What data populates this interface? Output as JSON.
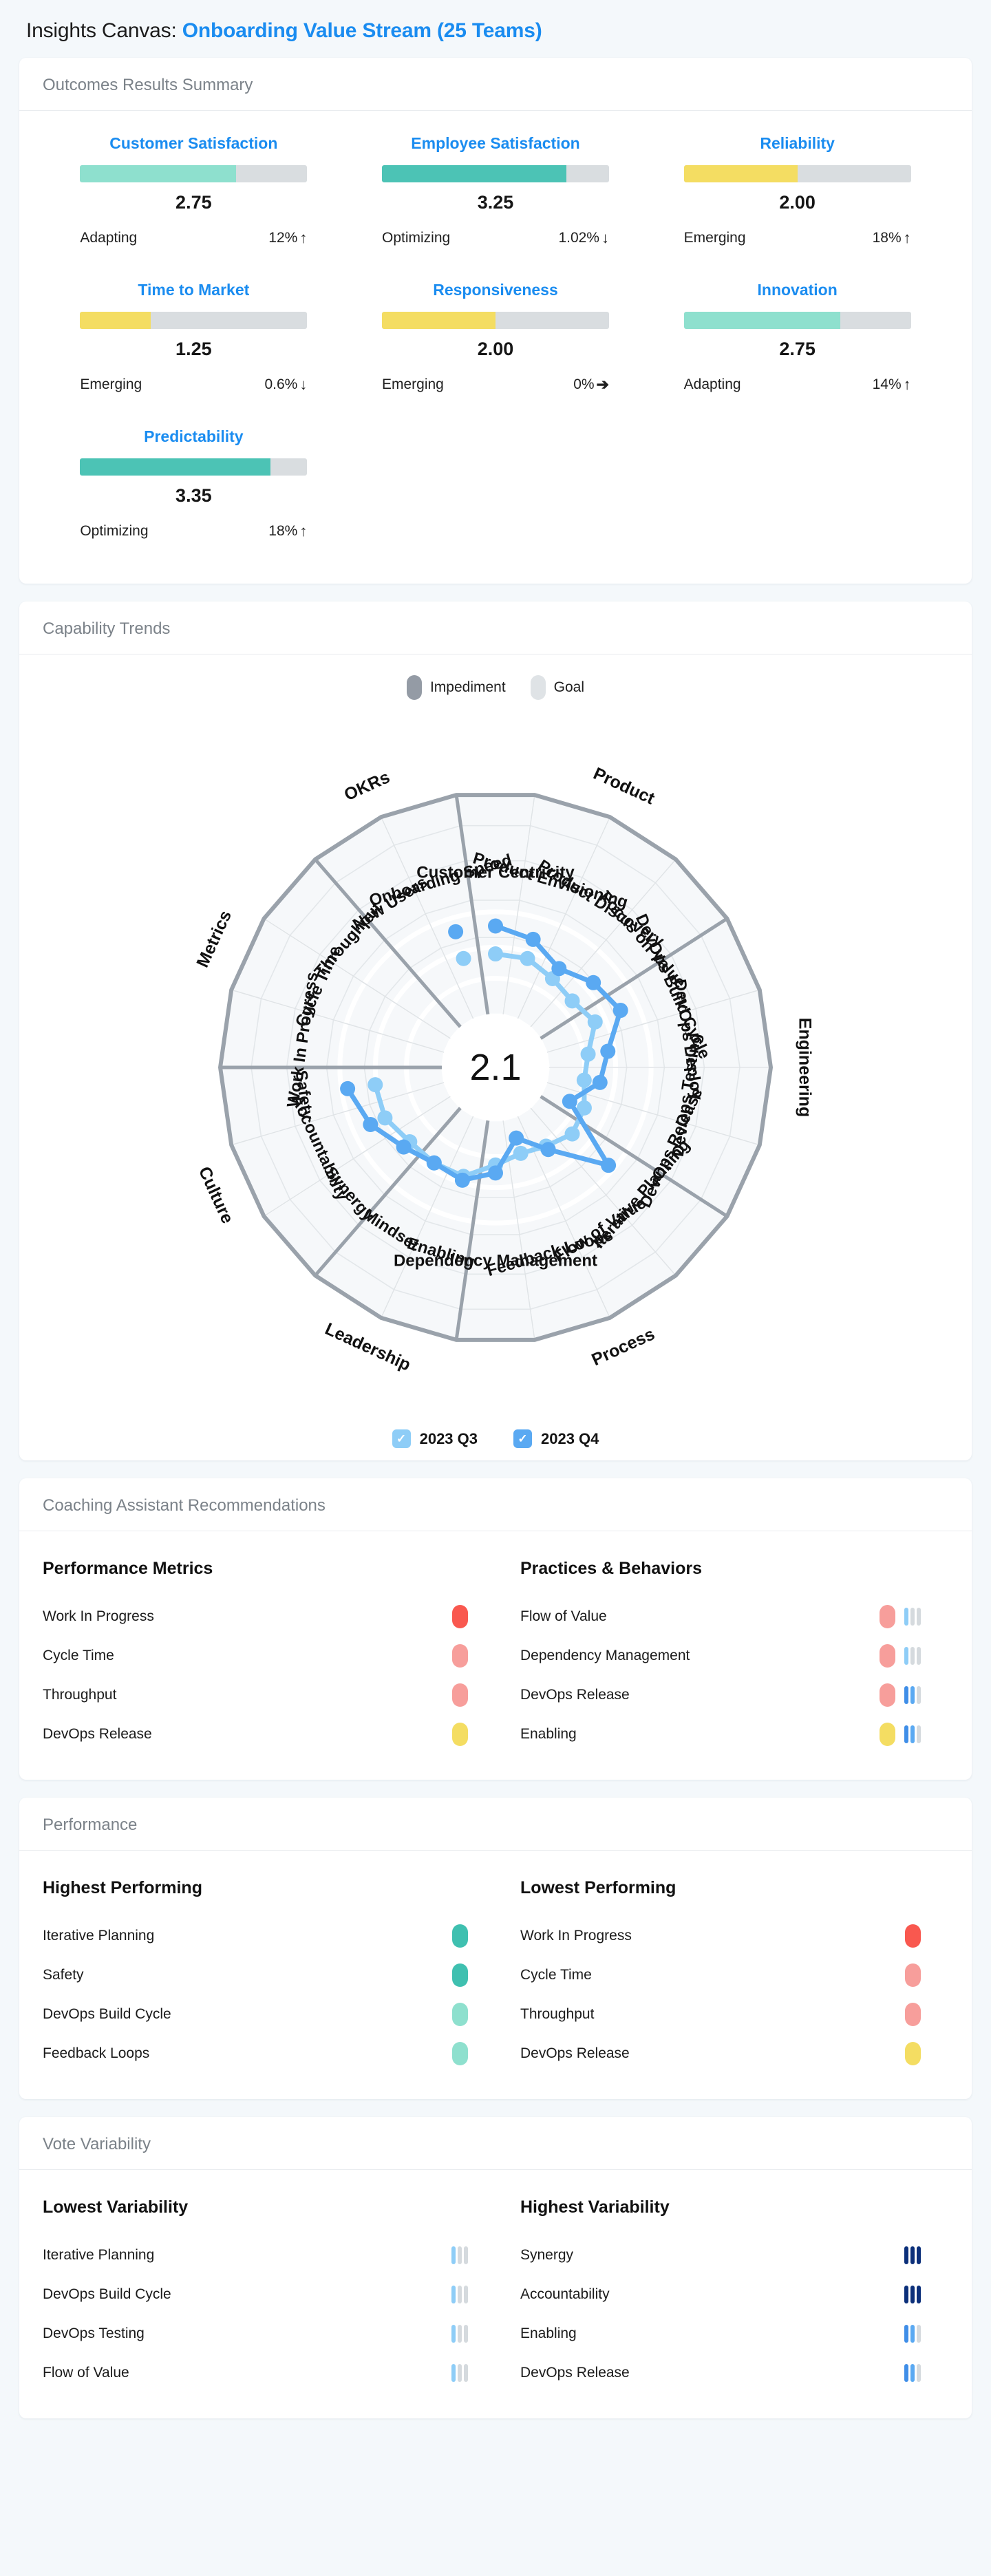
{
  "header": {
    "prefix": "Insights Canvas: ",
    "project": "Onboarding Value Stream (25 Teams)"
  },
  "outcomes": {
    "section_title": "Outcomes Results Summary",
    "max_score": 4,
    "items": [
      {
        "name": "Customer Satisfaction",
        "score": "2.75",
        "value": 2.75,
        "level": "Adapting",
        "delta": "12%",
        "direction": "up",
        "color": "#8ee0ce"
      },
      {
        "name": "Employee Satisfaction",
        "score": "3.25",
        "value": 3.25,
        "level": "Optimizing",
        "delta": "1.02%",
        "direction": "down",
        "color": "#4cc3b5"
      },
      {
        "name": "Reliability",
        "score": "2.00",
        "value": 2.0,
        "level": "Emerging",
        "delta": "18%",
        "direction": "up",
        "color": "#f4dd62"
      },
      {
        "name": "Time to Market",
        "score": "1.25",
        "value": 1.25,
        "level": "Emerging",
        "delta": "0.6%",
        "direction": "down",
        "color": "#f4dd62"
      },
      {
        "name": "Responsiveness",
        "score": "2.00",
        "value": 2.0,
        "level": "Emerging",
        "delta": "0%",
        "direction": "flat",
        "color": "#f4dd62"
      },
      {
        "name": "Innovation",
        "score": "2.75",
        "value": 2.75,
        "level": "Adapting",
        "delta": "14%",
        "direction": "up",
        "color": "#8ee0ce"
      },
      {
        "name": "Predictability",
        "score": "3.35",
        "value": 3.35,
        "level": "Optimizing",
        "delta": "18%",
        "direction": "up",
        "color": "#4cc3b5"
      }
    ]
  },
  "capability": {
    "section_title": "Capability Trends",
    "legend": [
      {
        "label": "Impediment",
        "color": "#949ba5"
      },
      {
        "label": "Goal",
        "color": "#dfe3e6"
      }
    ],
    "center_value": "2.1",
    "quarters": [
      {
        "label": "2023 Q3",
        "color": "#8ecdf7",
        "checked": true
      },
      {
        "label": "2023 Q4",
        "color": "#5aa9f2",
        "checked": true
      }
    ],
    "groups": [
      "Product",
      "Engineering",
      "Process",
      "Leadership",
      "Culture",
      "Metrics",
      "OKRs"
    ],
    "chart_data": {
      "type": "radar",
      "title": "Capability Trends",
      "axis_max": 4,
      "categories": [
        "Customer Centricity",
        "Product Envisioning",
        "Product Discovery",
        "Focus on Value",
        "DevOps Build Cycle",
        "DevOps Deploy",
        "DevOps Testing",
        "DevOps Release",
        "Iterative Planning",
        "Flow of Value",
        "Feedback Loops",
        "Dependency Management",
        "Enabling",
        "Mindset",
        "Synergy",
        "Accountability",
        "Safety",
        "Work In Progress",
        "Cycle Time",
        "Throughput",
        "New Users",
        "Onboarding Speed"
      ],
      "group_labels": [
        "Product",
        "Engineering",
        "Process",
        "Leadership",
        "Culture",
        "Metrics",
        "OKRs"
      ],
      "series": [
        {
          "name": "2023 Q3",
          "color": "#8ecdf7",
          "values": [
            1.5,
            1.5,
            1.3,
            1.2,
            1.4,
            1.0,
            0.9,
            1.1,
            1.2,
            1.0,
            0.9,
            1.1,
            1.5,
            1.5,
            1.5,
            1.7,
            1.7,
            0.0,
            0.0,
            0.0,
            0.0,
            1.5
          ]
        },
        {
          "name": "2023 Q4",
          "color": "#5aa9f2",
          "values": [
            2.2,
            2.0,
            1.6,
            1.9,
            2.1,
            1.5,
            1.3,
            0.7,
            2.4,
            1.1,
            0.5,
            1.3,
            1.6,
            1.5,
            1.7,
            2.1,
            2.4,
            0.0,
            0.0,
            0.0,
            0.0,
            2.2
          ]
        }
      ],
      "legend_position": "bottom",
      "grid": true
    }
  },
  "coaching": {
    "section_title": "Coaching Assistant Recommendations",
    "left": {
      "title": "Performance Metrics",
      "rows": [
        {
          "label": "Work In Progress",
          "dot": "#f9584f"
        },
        {
          "label": "Cycle Time",
          "dot": "#f79e9b"
        },
        {
          "label": "Throughput",
          "dot": "#f79e9b"
        },
        {
          "label": "DevOps Release",
          "dot": "#f4dd62"
        }
      ]
    },
    "right": {
      "title": "Practices & Behaviors",
      "rows": [
        {
          "label": "Flow of Value",
          "dot": "#f79e9b",
          "bars": [
            "#8ecdf7",
            "#d5dade",
            "#d5dade"
          ]
        },
        {
          "label": "Dependency Management",
          "dot": "#f79e9b",
          "bars": [
            "#8ecdf7",
            "#d5dade",
            "#d5dade"
          ]
        },
        {
          "label": "DevOps Release",
          "dot": "#f79e9b",
          "bars": [
            "#3f8ee8",
            "#5aa9f2",
            "#d5dade"
          ]
        },
        {
          "label": "Enabling",
          "dot": "#f4dd62",
          "bars": [
            "#3f8ee8",
            "#5aa9f2",
            "#d5dade"
          ]
        }
      ]
    }
  },
  "performance": {
    "section_title": "Performance",
    "left": {
      "title": "Highest Performing",
      "rows": [
        {
          "label": "Iterative Planning",
          "dot": "#3fc0b0"
        },
        {
          "label": "Safety",
          "dot": "#3fc0b0"
        },
        {
          "label": "DevOps Build Cycle",
          "dot": "#8ee0ce"
        },
        {
          "label": "Feedback Loops",
          "dot": "#8ee0ce"
        }
      ]
    },
    "right": {
      "title": "Lowest Performing",
      "rows": [
        {
          "label": "Work In Progress",
          "dot": "#f9584f"
        },
        {
          "label": "Cycle Time",
          "dot": "#f79e9b"
        },
        {
          "label": "Throughput",
          "dot": "#f79e9b"
        },
        {
          "label": "DevOps Release",
          "dot": "#f4dd62"
        }
      ]
    }
  },
  "variability": {
    "section_title": "Vote Variability",
    "left": {
      "title": "Lowest Variability",
      "rows": [
        {
          "label": "Iterative Planning",
          "bars": [
            "#8ecdf7",
            "#d5dade",
            "#d5dade"
          ]
        },
        {
          "label": "DevOps Build Cycle",
          "bars": [
            "#8ecdf7",
            "#d5dade",
            "#d5dade"
          ]
        },
        {
          "label": "DevOps Testing",
          "bars": [
            "#8ecdf7",
            "#d5dade",
            "#d5dade"
          ]
        },
        {
          "label": "Flow of Value",
          "bars": [
            "#8ecdf7",
            "#d5dade",
            "#d5dade"
          ]
        }
      ]
    },
    "right": {
      "title": "Highest Variability",
      "rows": [
        {
          "label": "Synergy",
          "bars": [
            "#0b2f7a",
            "#0b2f7a",
            "#0b2f7a"
          ]
        },
        {
          "label": "Accountability",
          "bars": [
            "#0b2f7a",
            "#0b2f7a",
            "#0b2f7a"
          ]
        },
        {
          "label": "Enabling",
          "bars": [
            "#3f8ee8",
            "#5aa9f2",
            "#d5dade"
          ]
        },
        {
          "label": "DevOps Release",
          "bars": [
            "#3f8ee8",
            "#5aa9f2",
            "#d5dade"
          ]
        }
      ]
    }
  },
  "icons": {
    "arrow_up": "↑",
    "arrow_down": "↓",
    "arrow_flat": "➔",
    "check": "✓"
  }
}
